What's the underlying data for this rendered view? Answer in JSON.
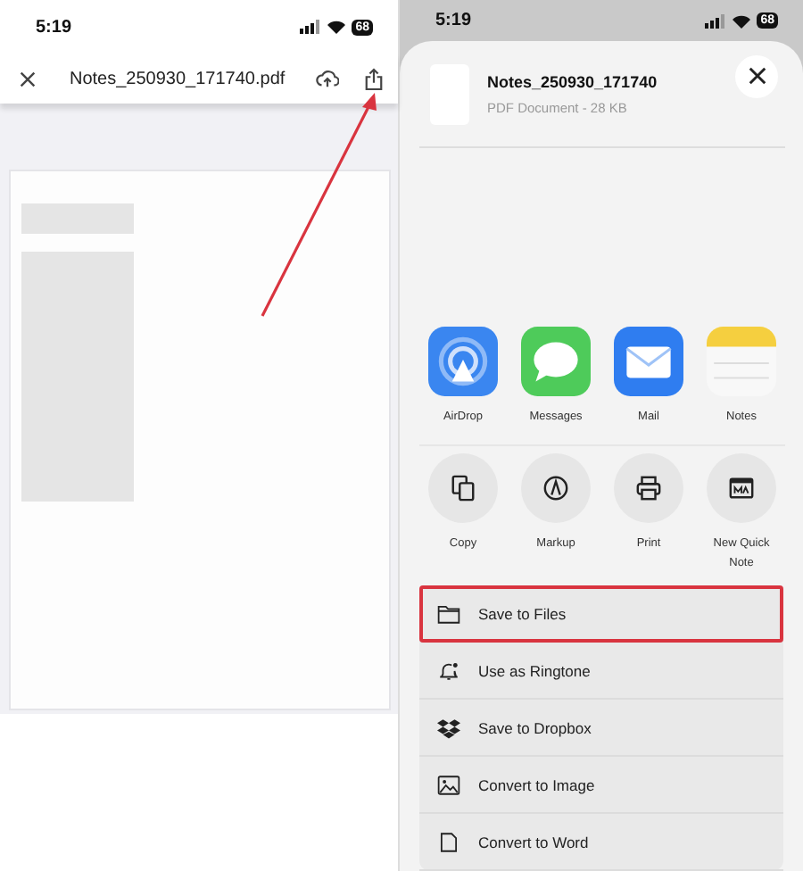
{
  "left": {
    "status_time": "5:19",
    "battery": "68",
    "title": "Notes_250930_171740.pdf"
  },
  "right": {
    "status_time": "5:19",
    "battery": "68",
    "file_name": "Notes_250930_171740",
    "file_info": "PDF Document - 28 KB",
    "apps": [
      {
        "label": "AirDrop",
        "kind": "airdrop"
      },
      {
        "label": "Messages",
        "kind": "messages"
      },
      {
        "label": "Mail",
        "kind": "mail"
      },
      {
        "label": "Notes",
        "kind": "notes"
      }
    ],
    "actions": [
      {
        "label": "Copy",
        "kind": "copy"
      },
      {
        "label": "Markup",
        "kind": "markup"
      },
      {
        "label": "Print",
        "kind": "print"
      },
      {
        "label": "New Quick Note",
        "kind": "quicknote"
      }
    ],
    "list": [
      {
        "label": "Save to Files",
        "kind": "folder",
        "highlighted": true
      },
      {
        "label": "Use as Ringtone",
        "kind": "bell",
        "highlighted": false
      },
      {
        "label": "Save to Dropbox",
        "kind": "dropbox",
        "highlighted": false
      },
      {
        "label": "Convert to Image",
        "kind": "image",
        "highlighted": false
      },
      {
        "label": "Convert to Word",
        "kind": "doc",
        "highlighted": false
      }
    ]
  }
}
